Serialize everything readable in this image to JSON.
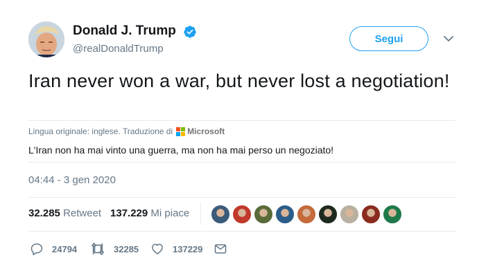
{
  "author": {
    "name": "Donald J. Trump",
    "handle": "@realDonaldTrump",
    "verified": true
  },
  "follow_label": "Segui",
  "tweet_text": "Iran never won a war, but never lost a negotiation!",
  "translation": {
    "note": "Lingua originale: inglese. Traduzione di",
    "provider": "Microsoft",
    "text": "L'Iran non ha mai vinto una guerra, ma non ha mai perso un negoziato!"
  },
  "timestamp": "04:44 - 3 gen 2020",
  "stats": {
    "retweets_count": "32.285",
    "retweets_label": "Retweet",
    "likes_count": "137.229",
    "likes_label": "Mi piace"
  },
  "liker_avatars": [
    {
      "color": "#3b5b7a"
    },
    {
      "color": "#c0392b"
    },
    {
      "color": "#5a6b3a"
    },
    {
      "color": "#2c5d8a"
    },
    {
      "color": "#c46a3b"
    },
    {
      "color": "#1f2a1f"
    },
    {
      "color": "#b8b0a0"
    },
    {
      "color": "#8a2b1e"
    },
    {
      "color": "#1e7a4a"
    }
  ],
  "actions": {
    "replies": "24794",
    "retweets": "32285",
    "likes": "137229"
  },
  "colors": {
    "accent": "#1da1f2",
    "secondary_text": "#657786",
    "separator": "#e6ecf0"
  },
  "icons": [
    "verified-badge-icon",
    "chevron-down-icon",
    "microsoft-logo-icon",
    "reply-icon",
    "retweet-icon",
    "like-icon",
    "direct-message-icon"
  ]
}
